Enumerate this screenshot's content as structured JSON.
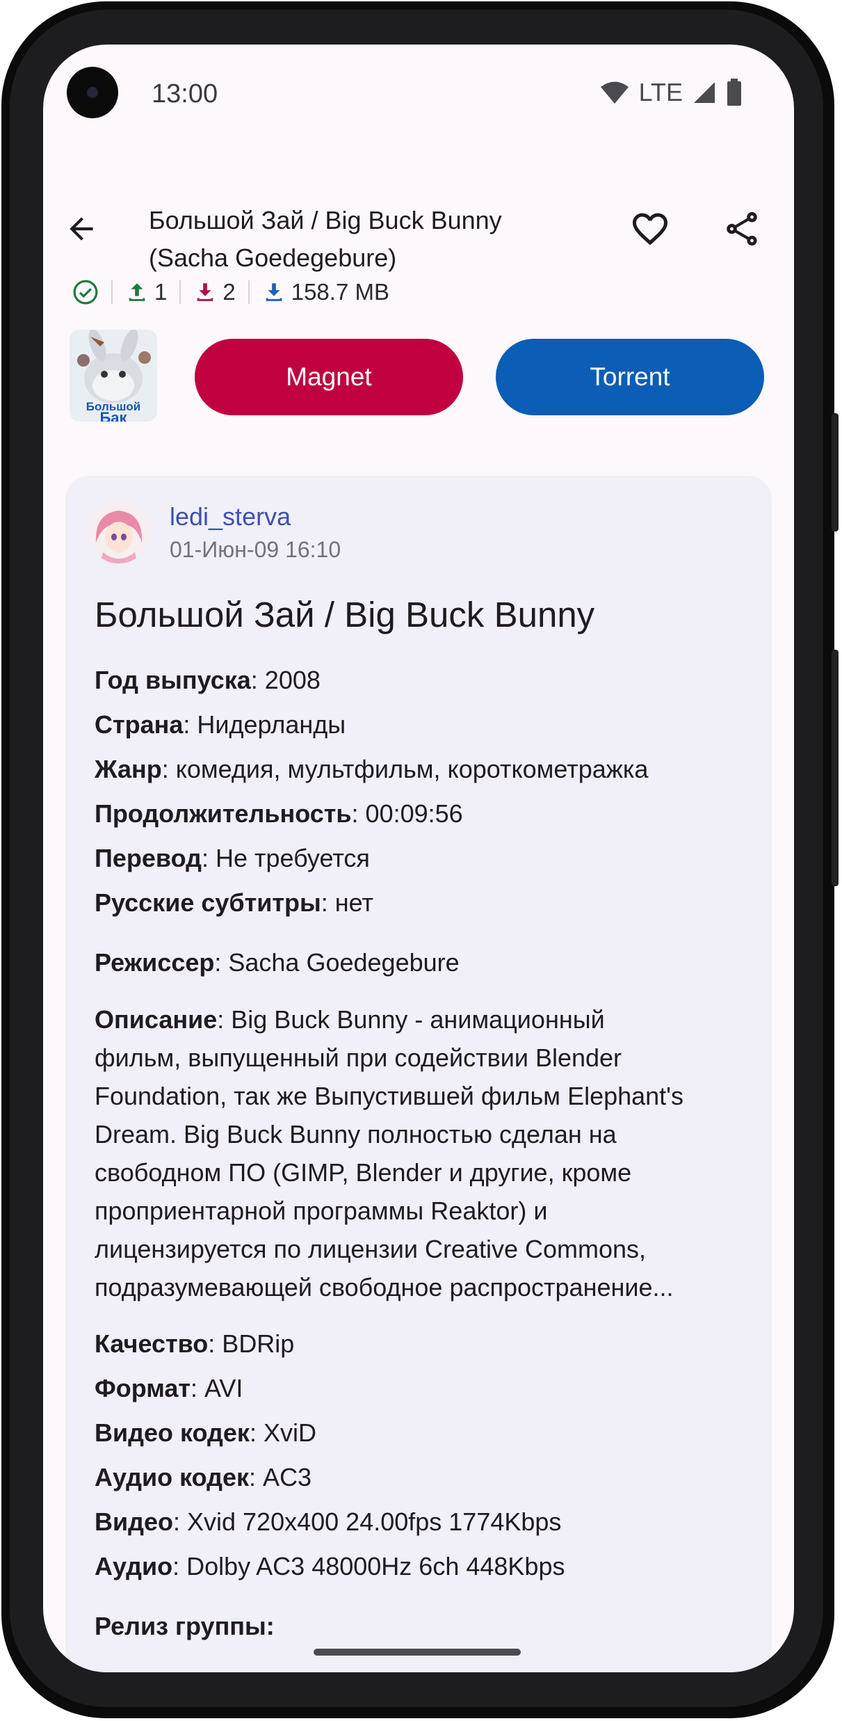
{
  "status_bar": {
    "time": "13:00",
    "network": "LTE"
  },
  "app_bar": {
    "title_line1": "Большой Зай / Big Buck Bunny",
    "title_line2": "(Sacha Goedegebure)"
  },
  "stats": {
    "seeds": "1",
    "leeches": "2",
    "size": "158.7 MB"
  },
  "actions": {
    "magnet": "Magnet",
    "torrent": "Torrent"
  },
  "cover": {
    "caption": "Большой",
    "caption2": "Бак"
  },
  "colors": {
    "magnet": "#c0003f",
    "torrent": "#0b5db5",
    "author": "#3f51b0",
    "seeds": "#1e7a3c",
    "leeches": "#b01245",
    "size": "#1f5fb3"
  },
  "post": {
    "author": "ledi_sterva",
    "date": "01-Июн-09 16:10",
    "title": "Большой Зай / Big Buck Bunny",
    "group1": [
      {
        "label": "Год выпуска",
        "value": ": 2008"
      },
      {
        "label": "Страна",
        "value": ": Нидерланды"
      },
      {
        "label": "Жанр",
        "value": ": комедия, мультфильм, короткометражка"
      },
      {
        "label": "Продолжительность",
        "value": ": 00:09:56"
      },
      {
        "label": "Перевод",
        "value": ": Не требуется"
      },
      {
        "label": "Русские субтитры",
        "value": ": нет"
      }
    ],
    "director": {
      "label": "Режиссер",
      "value": ": Sacha Goedegebure"
    },
    "description": {
      "label": "Описание",
      "lines": [
        ": Big Buck Bunny - анимационный",
        "фильм, выпущенный при содействии Blender",
        "Foundation, так же Выпустившей фильм Elephant's",
        "Dream. Big Buck Bunny полностью сделан на",
        "свободном ПО (GIMP, Blender и другие, кроме",
        "проприентарной программы Reaktor) и",
        "лицензируется по лицензии Creative Commons,",
        "подразумевающей свободное распространение..."
      ]
    },
    "group2": [
      {
        "label": "Качество",
        "value": ": BDRip"
      },
      {
        "label": "Формат",
        "value": ": AVI"
      },
      {
        "label": "Видео кодек",
        "value": ": XviD"
      },
      {
        "label": "Аудио кодек",
        "value": ": AC3"
      },
      {
        "label": "Видео",
        "value": ": Xvid 720x400 24.00fps 1774Kbps"
      },
      {
        "label": "Аудио",
        "value": ": Dolby AC3 48000Hz 6ch 448Kbps"
      }
    ],
    "release_group": {
      "label": "Релиз группы:"
    }
  }
}
